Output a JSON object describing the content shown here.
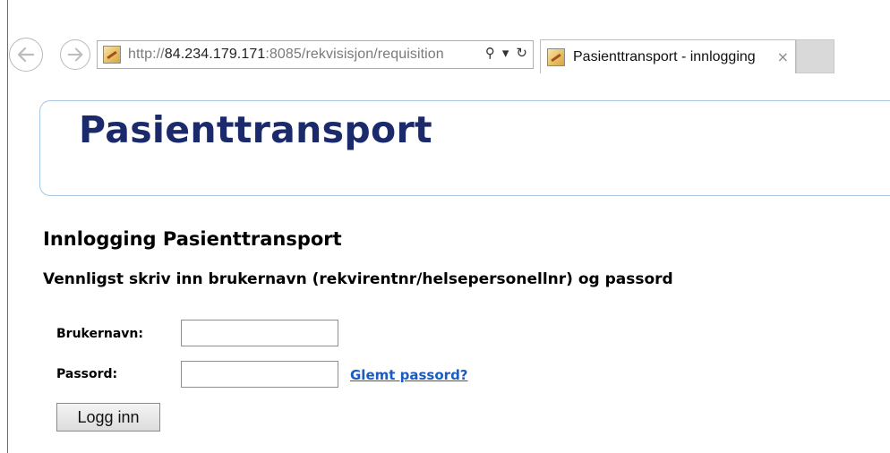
{
  "browser": {
    "url_scheme": "http://",
    "url_host": "84.234.179.171",
    "url_rest": ":8085/rekvisisjon/requisition",
    "tab_title": "Pasienttransport - innlogging",
    "tab_close_glyph": "×",
    "search_glyph": "⚲",
    "dropdown_glyph": "▾",
    "refresh_glyph": "↻",
    "icons": [
      "back-arrow-icon",
      "forward-arrow-icon",
      "site-favicon",
      "search-icon",
      "chevron-down-icon",
      "refresh-icon",
      "close-icon"
    ]
  },
  "page": {
    "banner_title": "Pasienttransport",
    "heading": "Innlogging Pasienttransport",
    "instruction": "Vennligst skriv inn brukernavn (rekvirentnr/helsepersonellnr) og passord",
    "username_label": "Brukernavn:",
    "username_value": "",
    "password_label": "Passord:",
    "password_value": "",
    "forgot_link": "Glemt passord?",
    "login_button": "Logg inn"
  },
  "colors": {
    "banner_title": "#1b2a6b",
    "banner_border": "#a9c6e3",
    "link": "#1d5bbf"
  }
}
